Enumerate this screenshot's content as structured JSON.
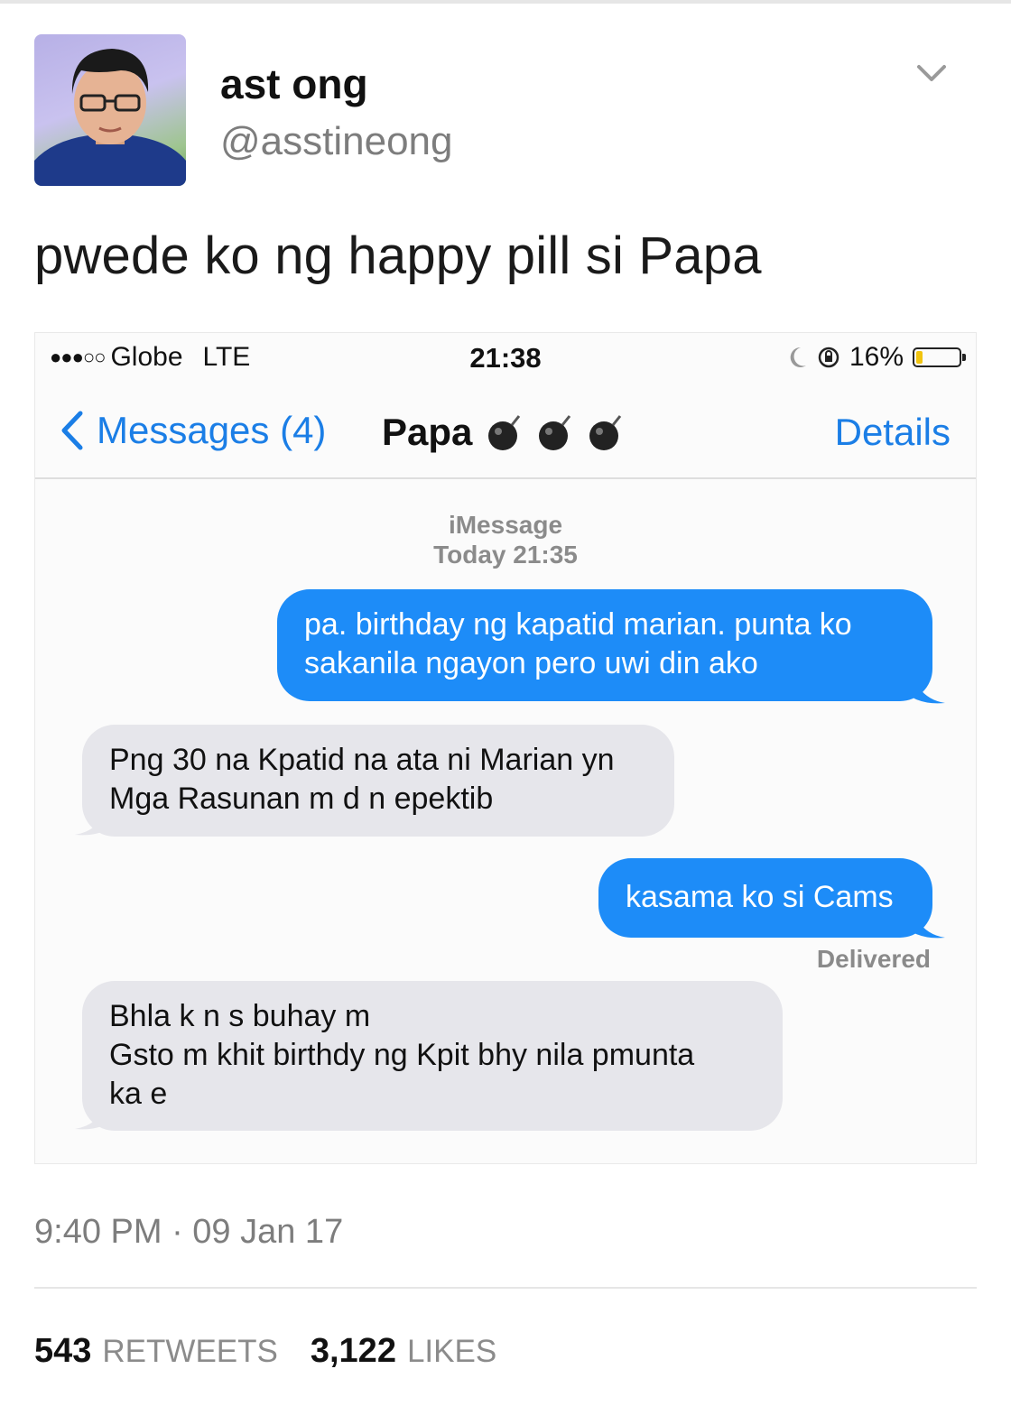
{
  "user": {
    "display_name": "ast ong",
    "handle": "@asstineong"
  },
  "tweet": {
    "text": "pwede ko ng happy pill si Papa",
    "timestamp": "9:40 PM · 09 Jan 17",
    "retweets_count": "543",
    "retweets_label": "RETWEETS",
    "likes_count": "3,122",
    "likes_label": "LIKES"
  },
  "screenshot": {
    "status_bar": {
      "carrier": "Globe",
      "network": "LTE",
      "time": "21:38",
      "battery": "16%",
      "battery_level": 0.16
    },
    "nav": {
      "back_label": "Messages (4)",
      "title": "Papa",
      "details_label": "Details"
    },
    "service": "iMessage",
    "service_time": "Today 21:35",
    "messages": [
      {
        "direction": "outgoing",
        "lines": [
          "pa. birthday ng kapatid marian. punta ko",
          "sakanila ngayon pero uwi din ako"
        ]
      },
      {
        "direction": "incoming",
        "lines": [
          "Png 30 na Kpatid na ata ni Marian yn",
          "Mga Rasunan m d n epektib"
        ]
      },
      {
        "direction": "outgoing",
        "lines": [
          "kasama ko si Cams"
        ]
      },
      {
        "direction": "incoming",
        "lines": [
          "Bhla k n s buhay m",
          "Gsto m khit birthdy ng Kpit bhy nila pmunta",
          "ka e"
        ]
      }
    ],
    "delivered_label": "Delivered"
  },
  "colors": {
    "ios_blue": "#1d8cf8",
    "link_blue": "#1b7ee6",
    "incoming_bubble": "#e6e6eb"
  }
}
